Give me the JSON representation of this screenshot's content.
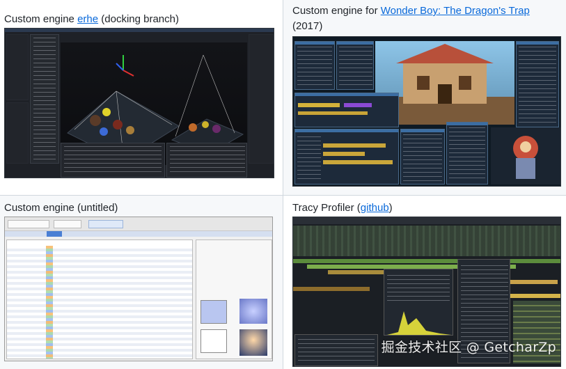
{
  "gallery": {
    "items": [
      {
        "caption_prefix": "Custom engine ",
        "link_text": "erhe",
        "caption_suffix": " (docking branch)"
      },
      {
        "caption_prefix": "Custom engine for ",
        "link_text": "Wonder Boy: The Dragon's Trap",
        "caption_suffix": "(2017)"
      },
      {
        "caption_prefix": "Custom engine (untitled)",
        "link_text": "",
        "caption_suffix": ""
      },
      {
        "caption_prefix": "Tracy Profiler (",
        "link_text": "github",
        "caption_suffix": ")"
      }
    ]
  },
  "watermark": {
    "text": "掘金技术社区 @ GetcharZp"
  },
  "colors": {
    "link": "#0969da",
    "border": "#d0d7de",
    "alt_bg": "#f6f8fa"
  }
}
